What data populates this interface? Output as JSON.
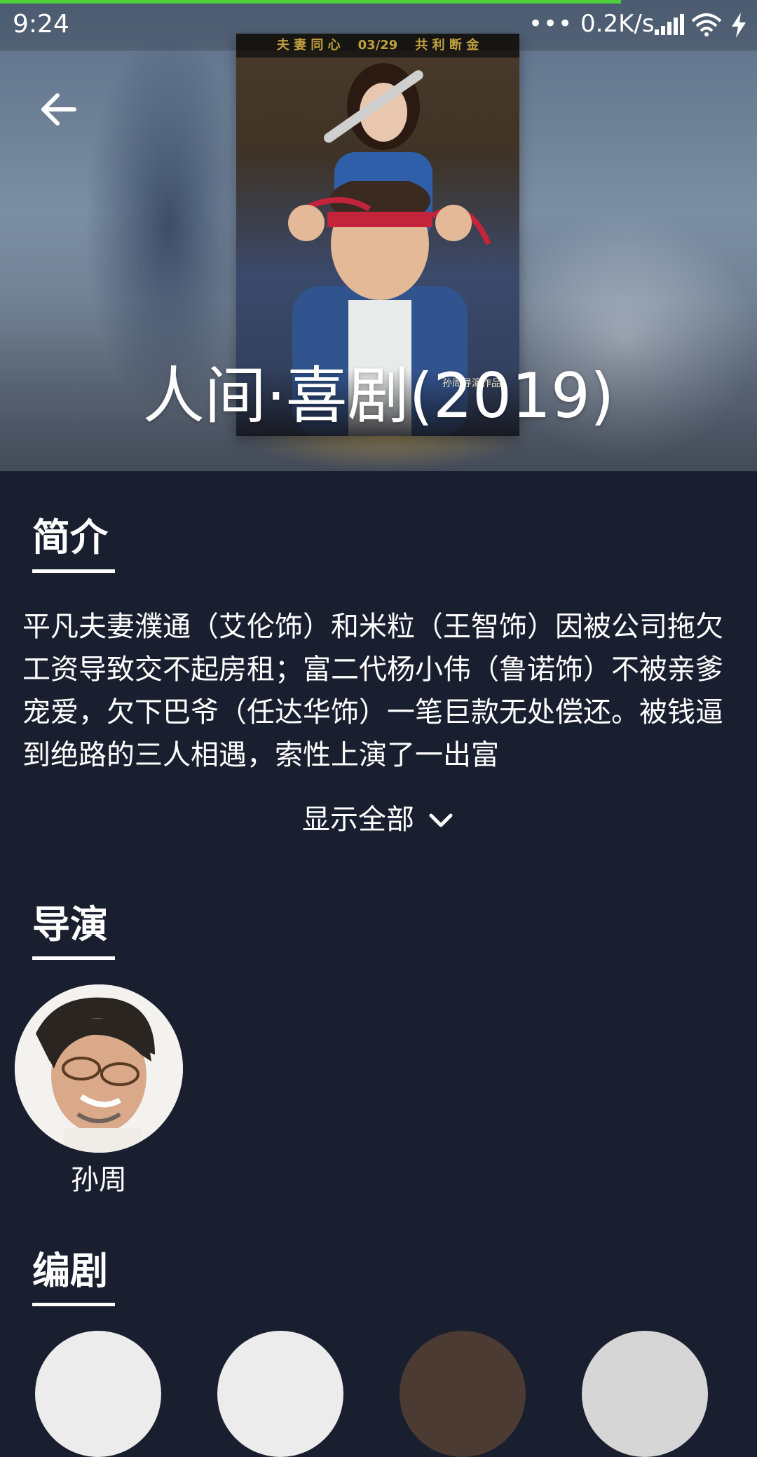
{
  "status_bar": {
    "time": "9:24",
    "overflow": "•••",
    "net_speed": "0.2K/s",
    "icons": [
      "signal-icon",
      "wifi-icon",
      "charging-icon"
    ]
  },
  "load_progress": 0.82,
  "colors": {
    "background": "#1a1f30",
    "progress": "#4cd13a",
    "text": "#ffffff"
  },
  "header": {
    "back_icon": "back-arrow-icon"
  },
  "poster": {
    "tagline": "夫 妻 同 心    03/29    共 利 断 金",
    "director_credit": "孙周导演作品"
  },
  "movie": {
    "title": "人间·喜剧(2019)"
  },
  "synopsis": {
    "heading": "简介",
    "text": "平凡夫妻濮通（艾伦饰）和米粒（王智饰）因被公司拖欠工资导致交不起房租；富二代杨小伟（鲁诺饰）不被亲爹宠爱，欠下巴爷（任达华饰）一笔巨款无处偿还。被钱逼到绝路的三人相遇，索性上演了一出富",
    "show_all_label": "显示全部"
  },
  "director": {
    "heading": "导演",
    "people": [
      {
        "name": "孙周"
      }
    ]
  },
  "writers": {
    "heading": "编剧"
  }
}
